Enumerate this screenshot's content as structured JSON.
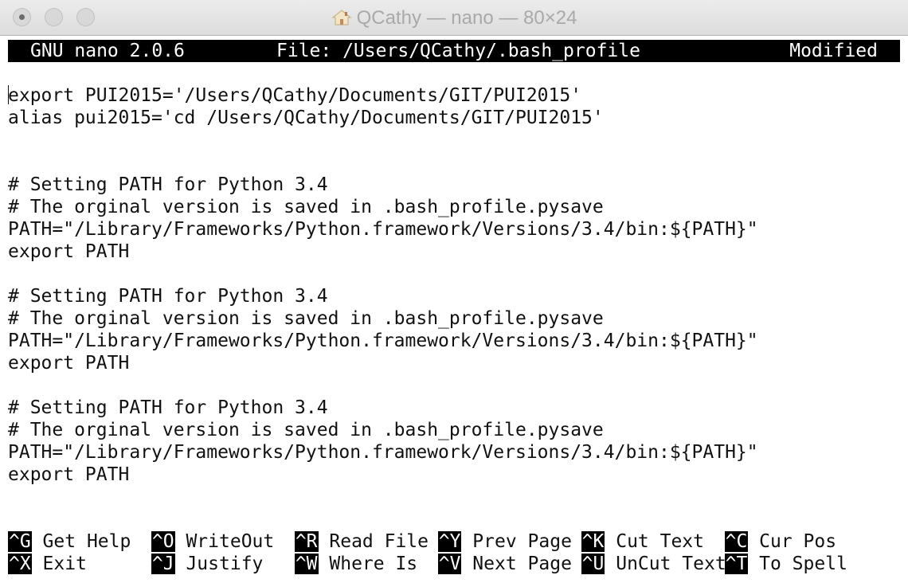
{
  "window": {
    "title": "QCathy — nano — 80×24"
  },
  "statusbar": {
    "version": "GNU nano 2.0.6",
    "file": "File: /Users/QCathy/.bash_profile",
    "state": "Modified"
  },
  "editor": {
    "lines": [
      "",
      "export PUI2015='/Users/QCathy/Documents/GIT/PUI2015'",
      "alias pui2015='cd /Users/QCathy/Documents/GIT/PUI2015'",
      "",
      "",
      "# Setting PATH for Python 3.4",
      "# The orginal version is saved in .bash_profile.pysave",
      "PATH=\"/Library/Frameworks/Python.framework/Versions/3.4/bin:${PATH}\"",
      "export PATH",
      "",
      "# Setting PATH for Python 3.4",
      "# The orginal version is saved in .bash_profile.pysave",
      "PATH=\"/Library/Frameworks/Python.framework/Versions/3.4/bin:${PATH}\"",
      "export PATH",
      "",
      "# Setting PATH for Python 3.4",
      "# The orginal version is saved in .bash_profile.pysave",
      "PATH=\"/Library/Frameworks/Python.framework/Versions/3.4/bin:${PATH}\"",
      "export PATH"
    ]
  },
  "shortcuts": {
    "row1": [
      {
        "key": "^G",
        "label": " Get Help"
      },
      {
        "key": "^O",
        "label": " WriteOut"
      },
      {
        "key": "^R",
        "label": " Read File"
      },
      {
        "key": "^Y",
        "label": " Prev Page"
      },
      {
        "key": "^K",
        "label": " Cut Text"
      },
      {
        "key": "^C",
        "label": " Cur Pos"
      }
    ],
    "row2": [
      {
        "key": "^X",
        "label": " Exit"
      },
      {
        "key": "^J",
        "label": " Justify"
      },
      {
        "key": "^W",
        "label": " Where Is"
      },
      {
        "key": "^V",
        "label": " Next Page"
      },
      {
        "key": "^U",
        "label": " UnCut Text"
      },
      {
        "key": "^T",
        "label": " To Spell"
      }
    ]
  }
}
